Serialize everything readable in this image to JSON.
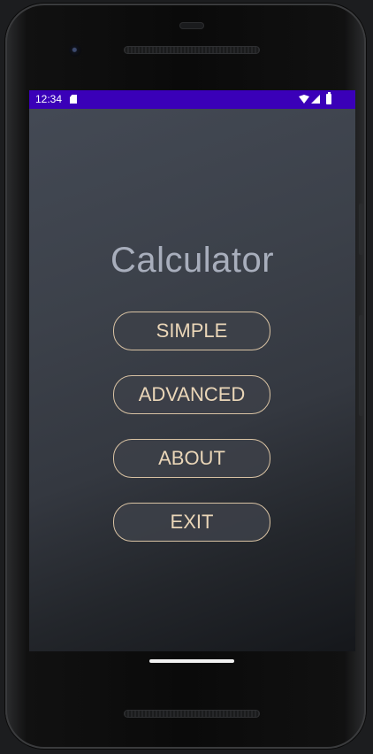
{
  "status_bar": {
    "time": "12:34",
    "icons": [
      "sd-card-icon",
      "wifi-icon",
      "cell-signal-icon",
      "battery-icon"
    ],
    "background": "#3a00b8"
  },
  "app": {
    "title": "Calculator",
    "buttons": {
      "simple": "SIMPLE",
      "advanced": "ADVANCED",
      "about": "ABOUT",
      "exit": "EXIT"
    }
  },
  "colors": {
    "title_text": "#a8aebc",
    "button_border": "#d8c2a3",
    "button_text": "#ead6b8",
    "screen_background": "#3c414a"
  }
}
